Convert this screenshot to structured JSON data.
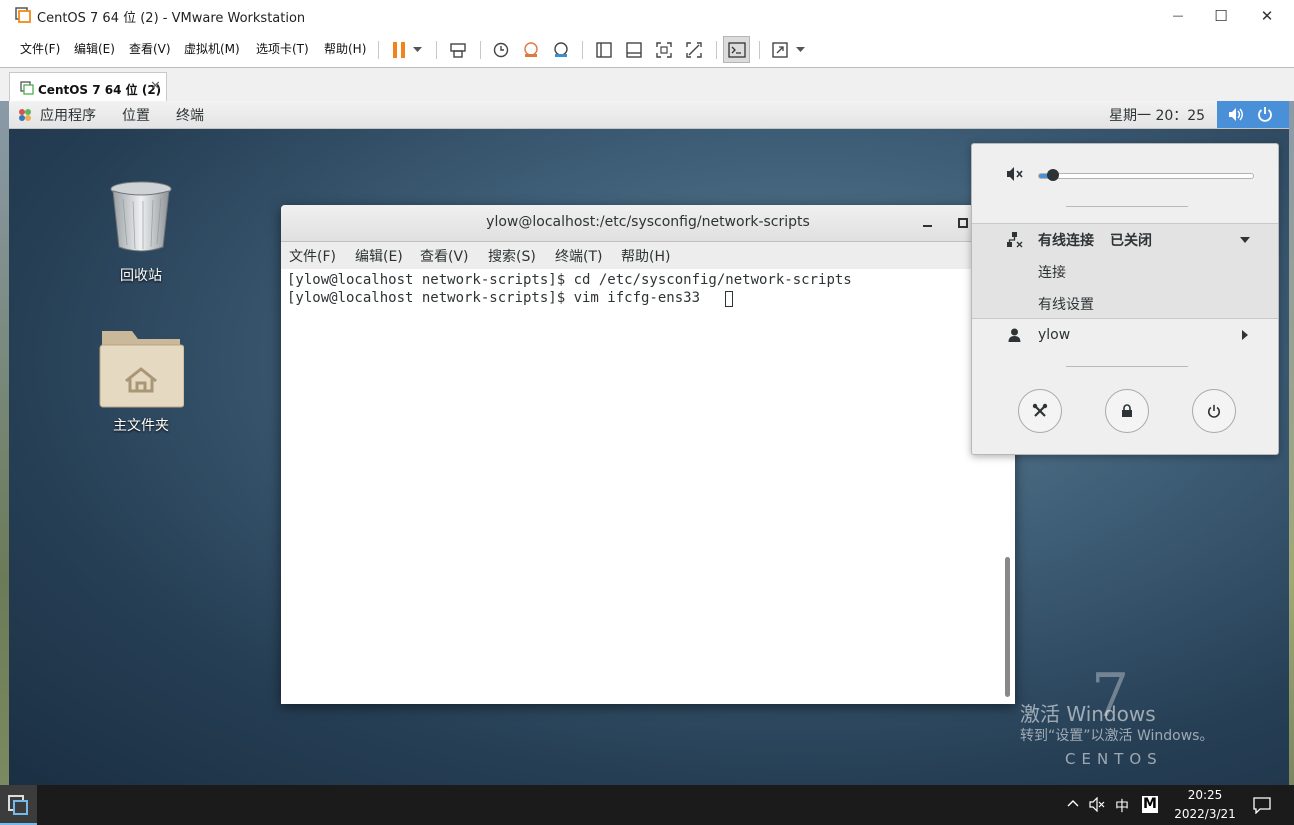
{
  "window": {
    "title": "CentOS 7 64 位 (2) - VMware Workstation",
    "minimize_glyph": "—",
    "maximize_glyph": "☐",
    "close_glyph": "✕"
  },
  "vmware_menu": [
    {
      "label": "文件(F)"
    },
    {
      "label": "编辑(E)"
    },
    {
      "label": "查看(V)"
    },
    {
      "label": "虚拟机(M)"
    },
    {
      "label": "选项卡(T)"
    },
    {
      "label": "帮助(H)"
    }
  ],
  "vm_tab": {
    "label": "CentOS 7 64 位 (2)",
    "close_glyph": "✕"
  },
  "gnome_topbar": {
    "menus": [
      "应用程序",
      "位置",
      "终端"
    ],
    "clock": "星期一 20：25"
  },
  "desktop": {
    "trash_label": "回收站",
    "home_label": "主文件夹"
  },
  "terminal": {
    "title": "ylow@localhost:/etc/sysconfig/network-scripts",
    "menus": [
      "文件(F)",
      "编辑(E)",
      "查看(V)",
      "搜索(S)",
      "终端(T)",
      "帮助(H)"
    ],
    "lines": [
      "[ylow@localhost network-scripts]$ cd /etc/sysconfig/network-scripts",
      "[ylow@localhost network-scripts]$ vim ifcfg-ens33"
    ]
  },
  "system_menu": {
    "volume_level": 0.05,
    "wired_title": "有线连接",
    "wired_status": "已关闭",
    "connect": "连接",
    "wired_settings": "有线设置",
    "user": "ylow"
  },
  "watermark": {
    "activate_line1": "激活 Windows",
    "activate_line2": "转到“设置”以激活 Windows。",
    "distro_number": "7",
    "distro_name": "CENTOS"
  },
  "taskbar": {
    "ime_lang": "中",
    "ime_mode": "M",
    "time": "20:25",
    "date": "2022/3/21"
  },
  "colors": {
    "accent": "#4a90d9",
    "pause": "#f0841e"
  }
}
